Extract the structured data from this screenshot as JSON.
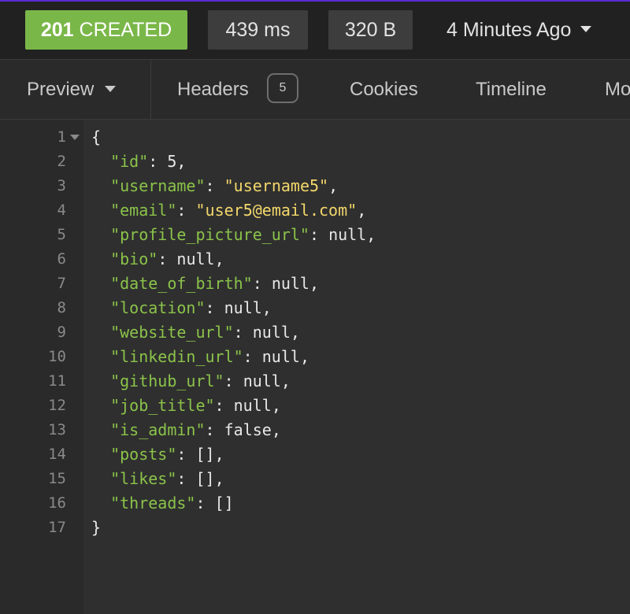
{
  "status": {
    "code": "201",
    "text": "CREATED",
    "time": "439 ms",
    "size": "320 B",
    "history": "4 Minutes Ago"
  },
  "tabs": {
    "preview_label": "Preview",
    "headers_label": "Headers",
    "headers_count": "5",
    "cookies_label": "Cookies",
    "timeline_label": "Timeline",
    "more_label": "Mo"
  },
  "colors": {
    "status_success": "#7ab749",
    "json_key": "#8bc34a",
    "json_string": "#f3d86b",
    "accent": "#5a2bd6"
  },
  "json_lines": [
    {
      "num": "1",
      "open": "{"
    },
    {
      "num": "2",
      "key": "\"id\"",
      "value": "5",
      "type": "lit",
      "comma": ","
    },
    {
      "num": "3",
      "key": "\"username\"",
      "value": "\"username5\"",
      "type": "str",
      "comma": ","
    },
    {
      "num": "4",
      "key": "\"email\"",
      "value": "\"user5@email.com\"",
      "type": "str",
      "comma": ","
    },
    {
      "num": "5",
      "key": "\"profile_picture_url\"",
      "value": "null",
      "type": "lit",
      "comma": ","
    },
    {
      "num": "6",
      "key": "\"bio\"",
      "value": "null",
      "type": "lit",
      "comma": ","
    },
    {
      "num": "7",
      "key": "\"date_of_birth\"",
      "value": "null",
      "type": "lit",
      "comma": ","
    },
    {
      "num": "8",
      "key": "\"location\"",
      "value": "null",
      "type": "lit",
      "comma": ","
    },
    {
      "num": "9",
      "key": "\"website_url\"",
      "value": "null",
      "type": "lit",
      "comma": ","
    },
    {
      "num": "10",
      "key": "\"linkedin_url\"",
      "value": "null",
      "type": "lit",
      "comma": ","
    },
    {
      "num": "11",
      "key": "\"github_url\"",
      "value": "null",
      "type": "lit",
      "comma": ","
    },
    {
      "num": "12",
      "key": "\"job_title\"",
      "value": "null",
      "type": "lit",
      "comma": ","
    },
    {
      "num": "13",
      "key": "\"is_admin\"",
      "value": "false",
      "type": "lit",
      "comma": ","
    },
    {
      "num": "14",
      "key": "\"posts\"",
      "value": "[]",
      "type": "lit",
      "comma": ","
    },
    {
      "num": "15",
      "key": "\"likes\"",
      "value": "[]",
      "type": "lit",
      "comma": ","
    },
    {
      "num": "16",
      "key": "\"threads\"",
      "value": "[]",
      "type": "lit",
      "comma": ""
    },
    {
      "num": "17",
      "close": "}"
    }
  ]
}
